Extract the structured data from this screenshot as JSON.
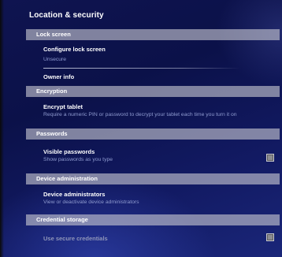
{
  "page": {
    "title": "Location & security"
  },
  "sections": [
    {
      "header": "Lock screen",
      "items": [
        {
          "title": "Configure lock screen",
          "subtitle": "Unsecure"
        },
        {
          "title": "Owner info"
        }
      ]
    },
    {
      "header": "Encryption",
      "items": [
        {
          "title": "Encrypt tablet",
          "subtitle": "Require a numeric PIN or password to decrypt your tablet each time you turn it on"
        }
      ]
    },
    {
      "header": "Passwords",
      "items": [
        {
          "title": "Visible passwords",
          "subtitle": "Show passwords as you type",
          "checked": false
        }
      ]
    },
    {
      "header": "Device administration",
      "items": [
        {
          "title": "Device administrators",
          "subtitle": "View or deactivate device administrators"
        }
      ]
    },
    {
      "header": "Credential storage",
      "items": [
        {
          "title": "Use secure credentials",
          "checked": false,
          "enabled": false
        }
      ]
    }
  ],
  "colors": {
    "background": "#0f1450",
    "section_header": "#c8c8d2",
    "title_text": "#ffffff",
    "subtitle_text": "#8f9bd0"
  },
  "icons": [
    "checkbox-icon"
  ]
}
